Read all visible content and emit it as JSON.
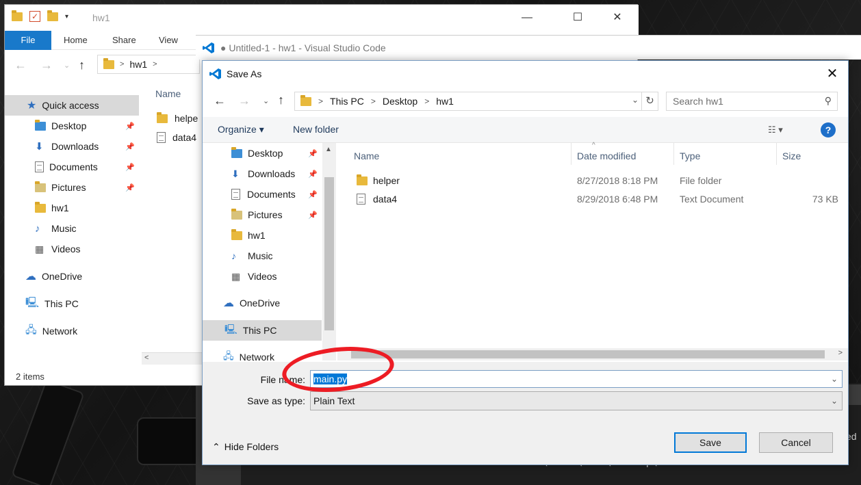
{
  "explorer": {
    "title": "hw1",
    "ribbon": [
      "File",
      "Home",
      "Share",
      "View"
    ],
    "address": [
      "hw1"
    ],
    "sidebar": [
      {
        "label": "Quick access",
        "icon": "star-icon",
        "selected": true
      },
      {
        "label": "Desktop",
        "icon": "folder-blue-icon",
        "pinned": true
      },
      {
        "label": "Downloads",
        "icon": "download-icon",
        "pinned": true
      },
      {
        "label": "Documents",
        "icon": "documents-icon",
        "pinned": true
      },
      {
        "label": "Pictures",
        "icon": "pictures-icon",
        "pinned": true
      },
      {
        "label": "hw1",
        "icon": "folder-icon"
      },
      {
        "label": "Music",
        "icon": "music-icon"
      },
      {
        "label": "Videos",
        "icon": "videos-icon"
      },
      {
        "label": "OneDrive",
        "icon": "cloud-icon"
      },
      {
        "label": "This PC",
        "icon": "computer-icon"
      },
      {
        "label": "Network",
        "icon": "network-icon"
      }
    ],
    "column_name": "Name",
    "files": [
      "helpe",
      "data4"
    ],
    "status": "2 items"
  },
  "vscode": {
    "title": "● Untitled-1 - hw1 - Visual Studio Code",
    "terminal_prompt": "PS C:\\Users\\Paul\\Desktop\\hw1>",
    "terminal_side": "ed"
  },
  "dialog": {
    "title": "Save As",
    "breadcrumb": [
      "This PC",
      "Desktop",
      "hw1"
    ],
    "search_placeholder": "Search hw1",
    "organize": "Organize ▾",
    "new_folder": "New folder",
    "help": "?",
    "tree": [
      {
        "label": "Desktop",
        "pinned": true
      },
      {
        "label": "Downloads",
        "pinned": true
      },
      {
        "label": "Documents",
        "pinned": true
      },
      {
        "label": "Pictures",
        "pinned": true
      },
      {
        "label": "hw1"
      },
      {
        "label": "Music"
      },
      {
        "label": "Videos"
      },
      {
        "label": "OneDrive"
      },
      {
        "label": "This PC",
        "selected": true
      },
      {
        "label": "Network"
      }
    ],
    "columns": [
      "Name",
      "Date modified",
      "Type",
      "Size"
    ],
    "rows": [
      {
        "name": "helper",
        "date": "8/27/2018 8:18 PM",
        "type": "File folder",
        "size": ""
      },
      {
        "name": "data4",
        "date": "8/29/2018 6:48 PM",
        "type": "Text Document",
        "size": "73 KB"
      }
    ],
    "file_name_label": "File name:",
    "file_name_value": "main.py",
    "save_type_label": "Save as type:",
    "save_type_value": "Plain Text",
    "hide_folders": "Hide Folders",
    "save": "Save",
    "cancel": "Cancel"
  },
  "annotation_color": "#ed1c24"
}
